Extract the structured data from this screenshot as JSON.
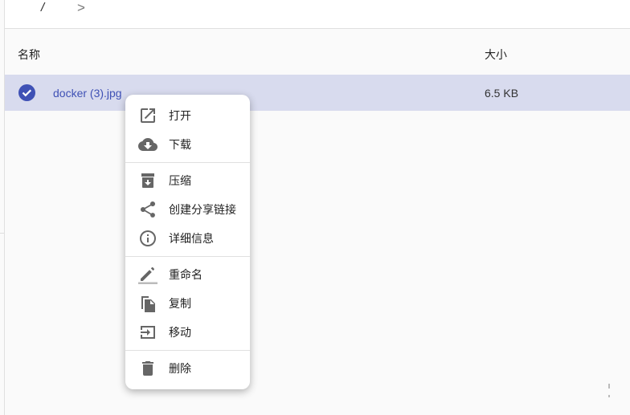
{
  "breadcrumb": {
    "root": "/",
    "separator": ">"
  },
  "table": {
    "headers": {
      "name": "名称",
      "size": "大小"
    },
    "rows": [
      {
        "name": "docker (3).jpg",
        "size": "6.5 KB",
        "selected": true
      }
    ]
  },
  "context_menu": {
    "items": [
      {
        "label": "打开",
        "icon": "open-in-new-icon"
      },
      {
        "label": "下载",
        "icon": "cloud-download-icon"
      },
      {
        "label": "压缩",
        "icon": "archive-icon"
      },
      {
        "label": "创建分享链接",
        "icon": "share-icon"
      },
      {
        "label": "详细信息",
        "icon": "info-icon"
      },
      {
        "label": "重命名",
        "icon": "rename-icon"
      },
      {
        "label": "复制",
        "icon": "copy-icon"
      },
      {
        "label": "移动",
        "icon": "move-icon"
      },
      {
        "label": "删除",
        "icon": "delete-icon"
      }
    ]
  },
  "colors": {
    "accent": "#3f51b5",
    "selected_row": "#d8dbee"
  }
}
